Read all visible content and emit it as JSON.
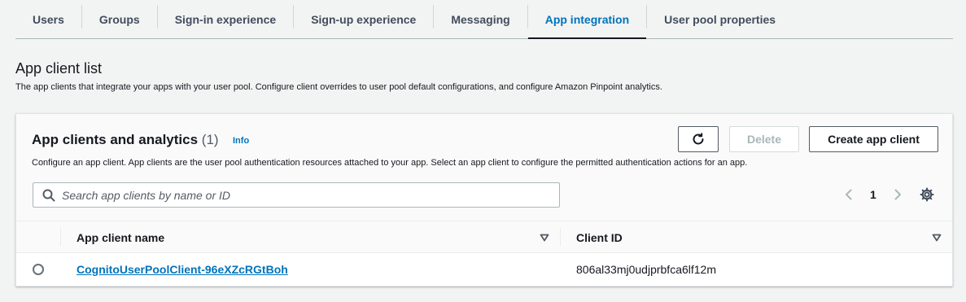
{
  "tabs": [
    {
      "label": "Users"
    },
    {
      "label": "Groups"
    },
    {
      "label": "Sign-in experience"
    },
    {
      "label": "Sign-up experience"
    },
    {
      "label": "Messaging"
    },
    {
      "label": "App integration",
      "active": true
    },
    {
      "label": "User pool properties"
    }
  ],
  "section": {
    "title": "App client list",
    "description": "The app clients that integrate your apps with your user pool. Configure client overrides to user pool default configurations, and configure Amazon Pinpoint analytics."
  },
  "card": {
    "title": "App clients and analytics",
    "count": "(1)",
    "info_label": "Info",
    "description": "Configure an app client. App clients are the user pool authentication resources attached to your app. Select an app client to configure the permitted authentication actions for an app.",
    "refresh_icon": "refresh-icon",
    "delete_label": "Delete",
    "create_label": "Create app client"
  },
  "search": {
    "placeholder": "Search app clients by name or ID",
    "value": ""
  },
  "pagination": {
    "current_page": "1"
  },
  "table": {
    "columns": [
      {
        "label": "App client name"
      },
      {
        "label": "Client ID"
      }
    ],
    "rows": [
      {
        "name": "CognitoUserPoolClient-96eXZcRGtBoh",
        "client_id": "806al33mj0udjprbfca6lf12m"
      }
    ]
  },
  "colors": {
    "accent": "#0073bb",
    "background": "#f2f3f3",
    "text": "#16191f"
  }
}
